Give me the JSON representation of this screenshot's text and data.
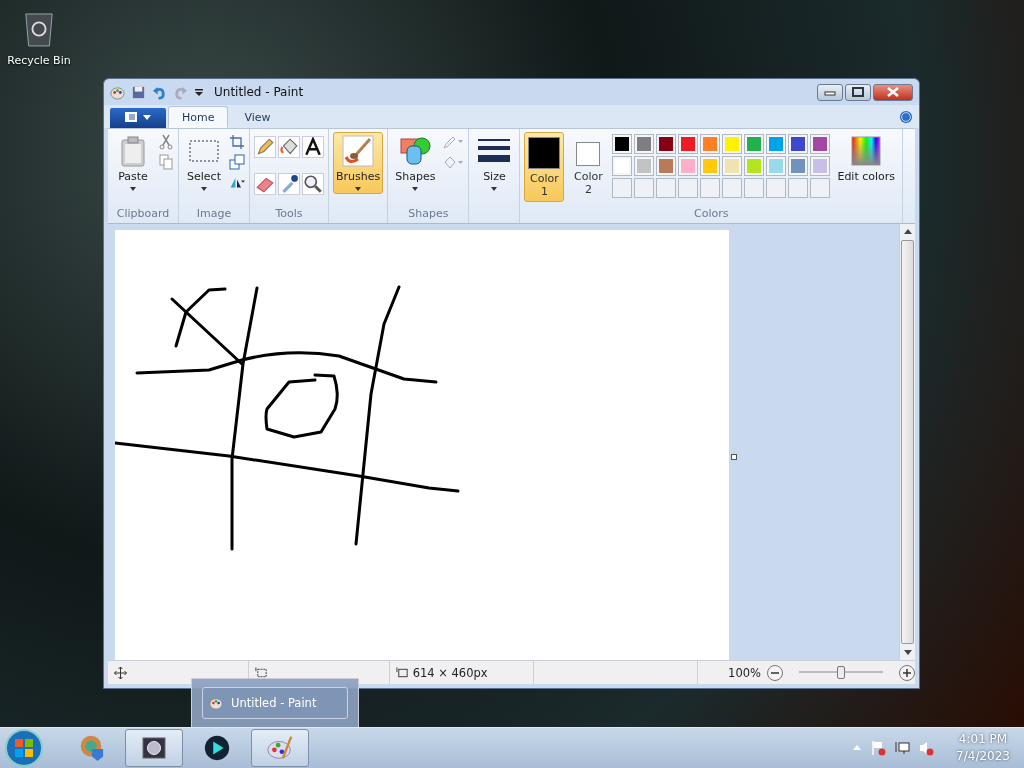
{
  "desktop_icons": [
    {
      "label": "Recycle Bin"
    }
  ],
  "window": {
    "title": "Untitled - Paint"
  },
  "tabs": [
    {
      "label": "Home",
      "selected": true
    },
    {
      "label": "View",
      "selected": false
    }
  ],
  "ribbon": {
    "clipboard": {
      "paste": "Paste",
      "group": "Clipboard"
    },
    "image": {
      "select": "Select",
      "group": "Image"
    },
    "tools": {
      "group": "Tools"
    },
    "brushes": {
      "label": "Brushes",
      "selected": true
    },
    "shapes": {
      "label": "Shapes",
      "group": "Shapes"
    },
    "size": {
      "label": "Size"
    },
    "color_slots": [
      {
        "label": "Color 1",
        "color": "#000000",
        "selected": true
      },
      {
        "label": "Color 2",
        "color": "#ffffff",
        "selected": false
      }
    ],
    "palette": [
      {
        "color": "#000000"
      },
      {
        "color": "#7f7f7f"
      },
      {
        "color": "#880015"
      },
      {
        "color": "#ed1c24"
      },
      {
        "color": "#ff7f27"
      },
      {
        "color": "#fff200"
      },
      {
        "color": "#22b14c"
      },
      {
        "color": "#00a2e8"
      },
      {
        "color": "#3f48cc"
      },
      {
        "color": "#a349a4"
      },
      {
        "color": "#ffffff"
      },
      {
        "color": "#c3c3c3"
      },
      {
        "color": "#b97a57"
      },
      {
        "color": "#ffaec9"
      },
      {
        "color": "#ffc90e"
      },
      {
        "color": "#efe4b0"
      },
      {
        "color": "#b5e61d"
      },
      {
        "color": "#99d9ea"
      },
      {
        "color": "#7092be"
      },
      {
        "color": "#c8bfe7"
      }
    ],
    "edit_colors": "Edit colors",
    "colors_group": "Colors"
  },
  "status_bar": {
    "dimensions": "614 × 460px",
    "zoom": "100%",
    "zoom_level": {
      "level": 0.5
    }
  },
  "taskbar": {
    "thumbnail": "Untitled - Paint",
    "items": [
      {
        "kind": "games",
        "running": false
      },
      {
        "kind": "explorer",
        "running": true
      },
      {
        "kind": "media",
        "running": false
      },
      {
        "kind": "paint",
        "running": true
      }
    ],
    "time": "4:01 PM",
    "date": "7/4/2023"
  }
}
